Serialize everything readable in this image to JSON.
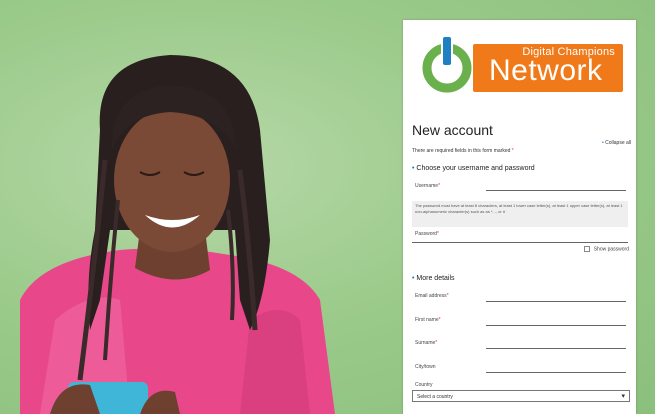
{
  "logo": {
    "small_text": "Digital Champions",
    "big_text": "Network"
  },
  "form": {
    "title": "New account",
    "required_note": "There are required fields in this form marked",
    "required_star": "*",
    "collapse_all": "Collapse all",
    "section_account": "Choose your username and password",
    "username_label": "Username",
    "password_hint": "The password must have at least 8 characters, at least 1 lower case letter(s), at least 1 upper case letter(s), at least 1 non-alphanumeric character(s) such as as *, -, or #",
    "password_label": "Password",
    "show_password": "Show password",
    "section_details": "More details",
    "email_label": "Email address",
    "firstname_label": "First name",
    "surname_label": "Surname",
    "city_label": "City/town",
    "country_label": "Country",
    "country_value": "Select a country"
  },
  "colors": {
    "brand_orange": "#f07a1a",
    "brand_green": "#6ab04c",
    "brand_blue": "#1f7fc2",
    "background_green": "#9ccb8c"
  }
}
